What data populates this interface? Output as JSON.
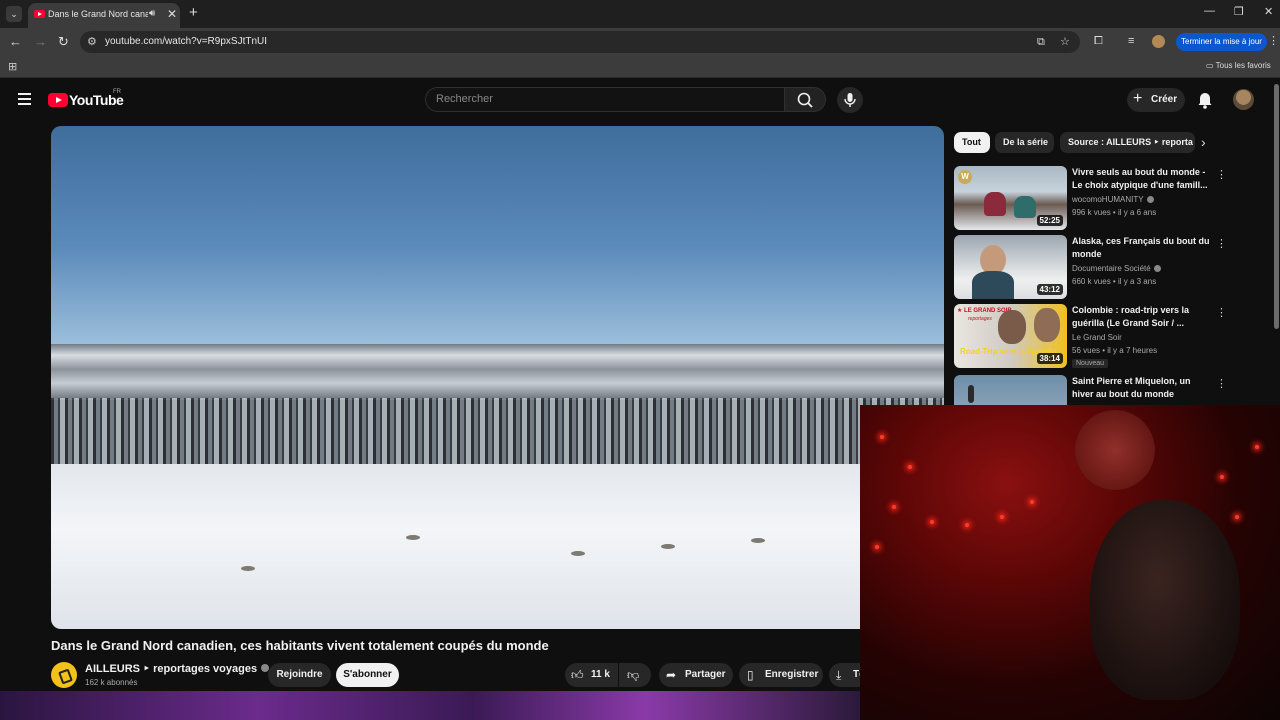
{
  "browser": {
    "tab_title": "Dans le Grand Nord canadien, ces habitants vivent totalement coupés du monde",
    "url": "youtube.com/watch?v=R9pxSJtTnUI",
    "update_button": "Terminer la mise à jour",
    "bookmarks_folder": "Tous les favoris"
  },
  "youtube": {
    "logo": "YouTube",
    "country": "FR",
    "search_placeholder": "Rechercher",
    "create_label": "Créer"
  },
  "video": {
    "title": "Dans le Grand Nord canadien, ces habitants vivent totalement coupés du monde",
    "channel": "AILLEURS ‣ reportages voyages",
    "subscribers": "162 k abonnés",
    "join_label": "Rejoindre",
    "subscribe_label": "S'abonner",
    "likes": "11 k",
    "share_label": "Partager",
    "save_label": "Enregistrer",
    "download_label": "Té"
  },
  "chips": [
    "Tout",
    "De la série",
    "Source : AILLEURS ‣ reporta"
  ],
  "recommendations": [
    {
      "title": "Vivre seuls au bout du monde - Le choix atypique d'une famill...",
      "channel": "wocomoHUMANITY",
      "views": "996 k vues",
      "age": "il y a 6 ans",
      "duration": "52:25",
      "verified": true,
      "badge": ""
    },
    {
      "title": "Alaska, ces Français du bout du monde",
      "channel": "Documentaire Société",
      "views": "660 k vues",
      "age": "il y a 3 ans",
      "duration": "43:12",
      "verified": true,
      "badge": ""
    },
    {
      "title": "Colombie : road-trip vers la guérilla (Le Grand Soir / ...",
      "channel": "Le Grand Soir",
      "views": "56 vues",
      "age": "il y a 7 heures",
      "duration": "38:14",
      "verified": false,
      "badge": "Nouveau"
    },
    {
      "title": "Saint Pierre et Miquelon, un hiver au bout du monde",
      "channel": "",
      "views": "",
      "age": "",
      "duration": "",
      "verified": false,
      "badge": ""
    }
  ],
  "thumb_texts": {
    "w_badge": "W",
    "grand_soir_logo": "★ LE GRAND SOIR",
    "grand_soir_sub": "reportages",
    "grand_soir_overlay": "Road-Trip vers la Guérilla"
  },
  "colors": {
    "accent_red": "#ff0033",
    "update_blue": "#0b57d0",
    "background": "#0f0f0f"
  }
}
